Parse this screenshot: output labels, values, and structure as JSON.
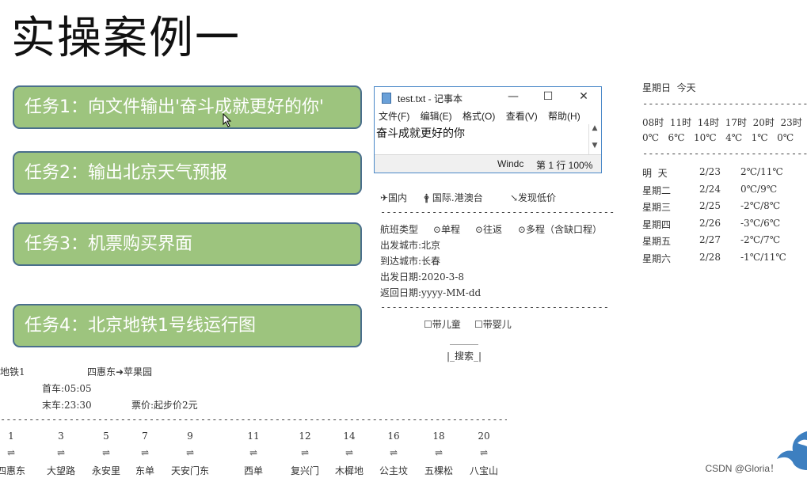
{
  "slide_title": "实操案例一",
  "tasks": [
    "任务1：向文件输出'奋斗成就更好的你'",
    "任务2：输出北京天气预报",
    "任务3：机票购买界面",
    "任务4：北京地铁1号线运行图"
  ],
  "notepad": {
    "title": "test.txt - 记事本",
    "minimize": "—",
    "maximize": "☐",
    "close": "✕",
    "menu": [
      "文件(F)",
      "编辑(E)",
      "格式(O)",
      "查看(V)",
      "帮助(H)"
    ],
    "content": "奋斗成就更好的你",
    "status_left": "Windc",
    "status_pos": "第 1 行 100%"
  },
  "flight": {
    "tabs": [
      "✈国内",
      "🛉 国际.港澳台",
      "↘发现低价"
    ],
    "divider": "------------------------------------------",
    "type_label": "航班类型",
    "types": [
      "⊙单程",
      "⊙往返",
      "⊙多程（含缺口程）"
    ],
    "depart_city": "出发城市:北京",
    "arrive_city": "到达城市:长春",
    "depart_date": "出发日期:2020-3-8",
    "return_date": "返回日期:yyyy-MM-dd",
    "divider2": "------------------------------------------",
    "child": "☐带儿童",
    "infant": "☐带婴儿",
    "search_top": "______",
    "search": "|_搜索_|"
  },
  "weather": {
    "header": "星期日  今天",
    "divider": "------------------------------",
    "hours": "08时  11时  14时  17时  20时  23时",
    "temps": "0℃   6℃   10℃   4℃   1℃   0℃",
    "divider2": "------------------------------",
    "days": [
      {
        "day": "明  天",
        "date": "2/23",
        "temp": "2℃/11℃"
      },
      {
        "day": "星期二",
        "date": "2/24",
        "temp": "0℃/9℃"
      },
      {
        "day": "星期三",
        "date": "2/25",
        "temp": "-2℃/8℃"
      },
      {
        "day": "星期四",
        "date": "2/26",
        "temp": "-3℃/6℃"
      },
      {
        "day": "星期五",
        "date": "2/27",
        "temp": "-2℃/7℃"
      },
      {
        "day": "星期六",
        "date": "2/28",
        "temp": "-1℃/11℃"
      }
    ]
  },
  "subway": {
    "line": "地铁1",
    "route": "四惠东➜苹果园",
    "first": "首车:05:05",
    "last": "末车:23:30",
    "fare": "票价:起步价2元",
    "divider": "------------------------------------------------------------------------------------------------------",
    "arrow": "⇌",
    "stations": [
      {
        "num": "1",
        "name": "四惠东"
      },
      {
        "num": "3",
        "name": "大望路"
      },
      {
        "num": "5",
        "name": "永安里"
      },
      {
        "num": "7",
        "name": "东单"
      },
      {
        "num": "9",
        "name": "天安门东"
      },
      {
        "num": "11",
        "name": "西单"
      },
      {
        "num": "12",
        "name": "复兴门"
      },
      {
        "num": "14",
        "name": "木樨地"
      },
      {
        "num": "16",
        "name": "公主坟"
      },
      {
        "num": "18",
        "name": "五棵松"
      },
      {
        "num": "20",
        "name": "八宝山"
      }
    ]
  },
  "watermark": "CSDN @Gloria！",
  "colors": {
    "task_fill": "#9dc47e",
    "task_border": "#4a6f8c",
    "notepad_accent": "#4a88c8"
  }
}
